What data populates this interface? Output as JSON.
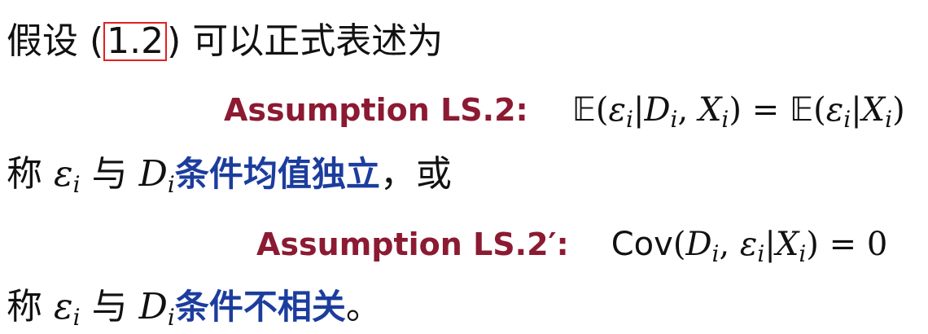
{
  "colors": {
    "assumption": "#8b1a32",
    "term": "#1c3d9e",
    "ref_box": "#e02020",
    "text": "#111111"
  },
  "line1": {
    "prefix": "假设 (",
    "ref": "1.2",
    "suffix": ") 可以正式表述为"
  },
  "assumption1": {
    "label": "Assumption LS.2:",
    "formula": {
      "E1": "𝔼",
      "open1": "(",
      "eps1": "ε",
      "sub_i1": "i",
      "bar1": "|",
      "D": "D",
      "sub_i2": "i",
      "comma": ", ",
      "X1": "X",
      "sub_i3": "i",
      "close1": ")",
      "eq": " = ",
      "E2": "𝔼",
      "open2": "(",
      "eps2": "ε",
      "sub_i4": "i",
      "bar2": "|",
      "X2": "X",
      "sub_i5": "i",
      "close2": ")"
    }
  },
  "line3": {
    "prefix": "称 ",
    "eps": "ε",
    "sub_i1": "i",
    "mid": " 与 ",
    "D": "D",
    "sub_i2": "i",
    "term": "条件均值独立",
    "suffix": "，或"
  },
  "assumption2": {
    "label": "Assumption LS.2′:",
    "formula": {
      "cov": "Cov",
      "open": "(",
      "D": "D",
      "sub_i1": "i",
      "comma": ", ",
      "eps": "ε",
      "sub_i2": "i",
      "bar": "|",
      "X": "X",
      "sub_i3": "i",
      "close": ")",
      "eq": " = 0"
    }
  },
  "line5": {
    "prefix": "称 ",
    "eps": "ε",
    "sub_i1": "i",
    "mid": " 与 ",
    "D": "D",
    "sub_i2": "i",
    "term": "条件不相关",
    "suffix": "。"
  }
}
